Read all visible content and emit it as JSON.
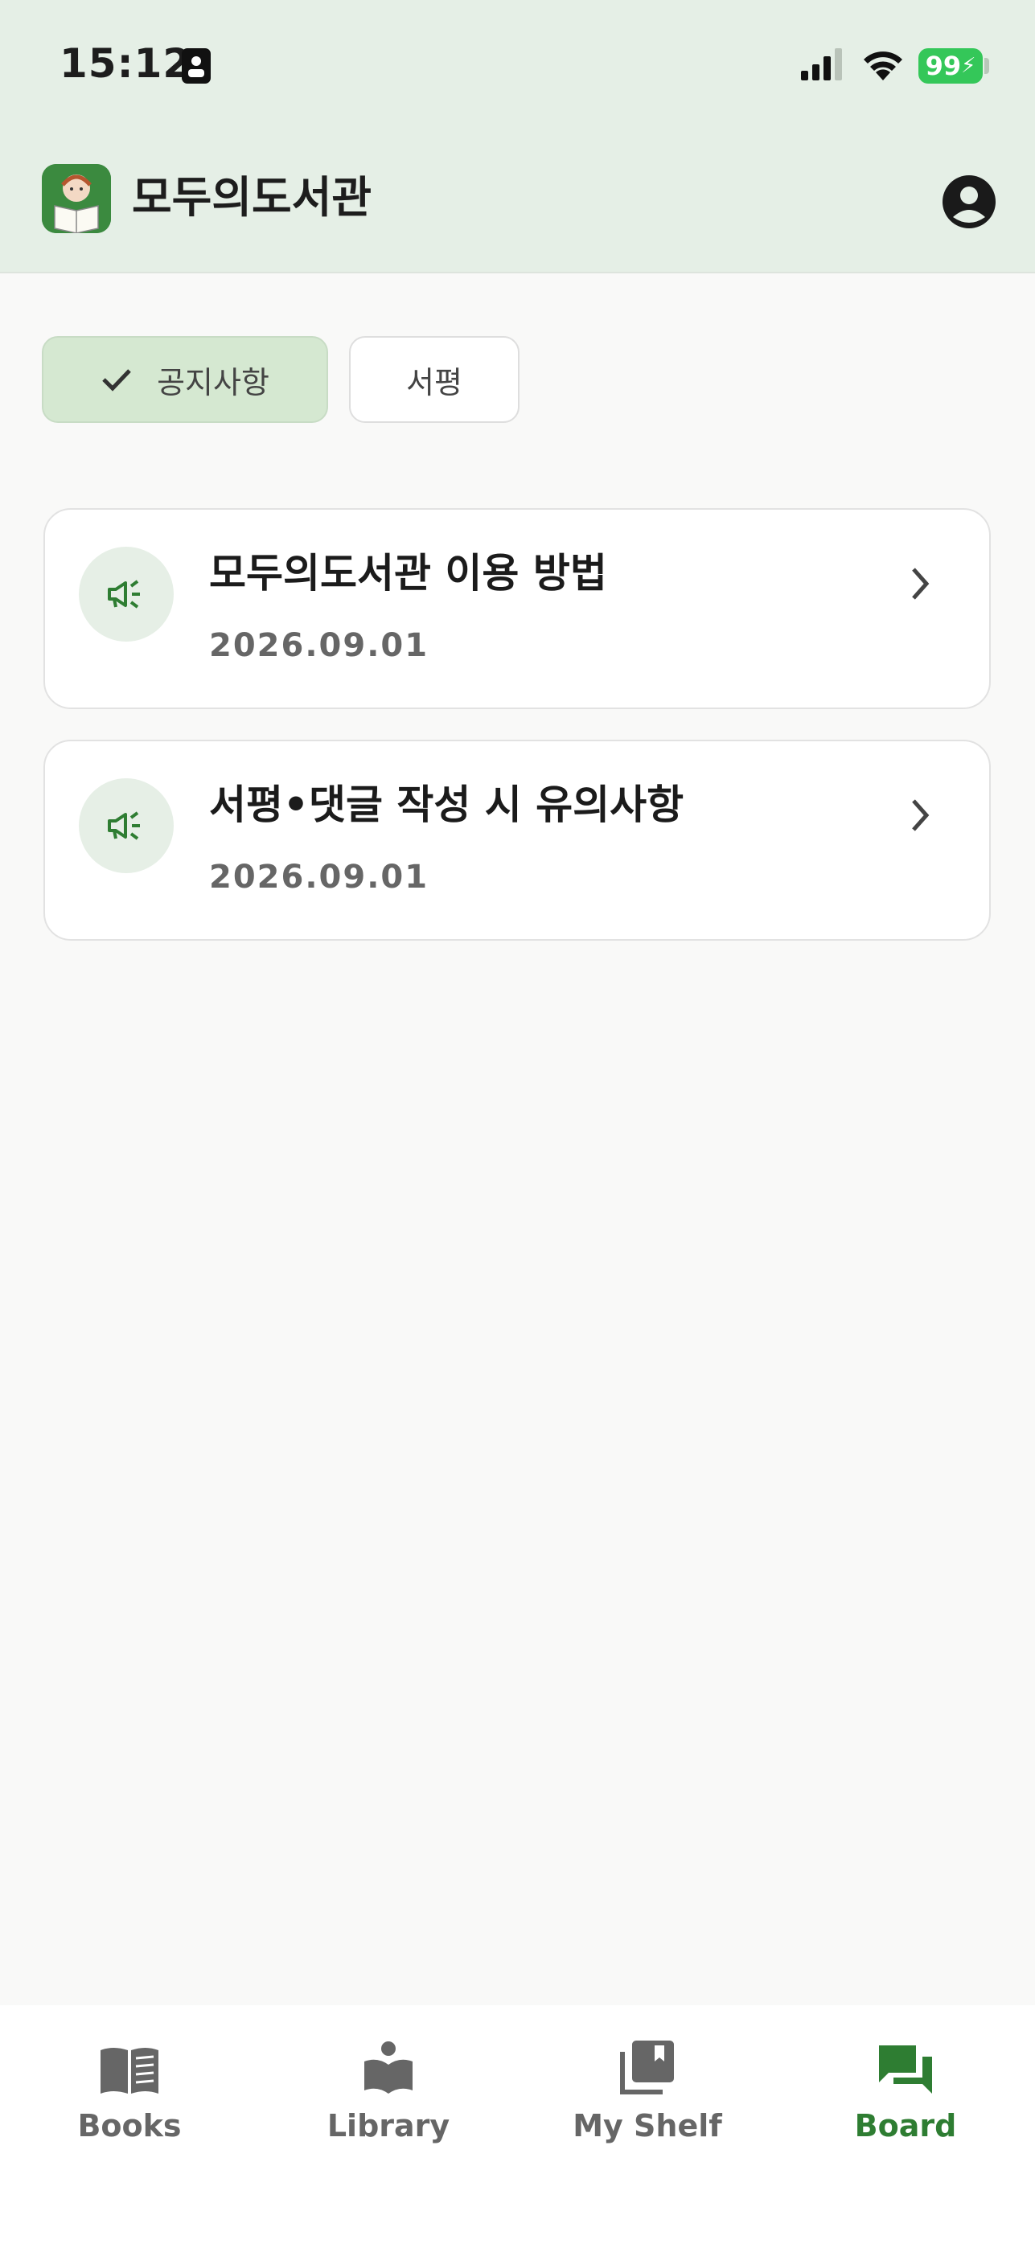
{
  "status_bar": {
    "time": "15:12",
    "battery": "99"
  },
  "header": {
    "app_title": "모두의도서관"
  },
  "filters": [
    {
      "label": "공지사항",
      "selected": true
    },
    {
      "label": "서평",
      "selected": false
    }
  ],
  "notices": [
    {
      "title": "모두의도서관 이용 방법",
      "date": "2026.09.01"
    },
    {
      "title": "서평•댓글 작성 시 유의사항",
      "date": "2026.09.01"
    }
  ],
  "bottom_nav": [
    {
      "label": "Books",
      "icon": "book-icon",
      "active": false
    },
    {
      "label": "Library",
      "icon": "library-icon",
      "active": false
    },
    {
      "label": "My Shelf",
      "icon": "shelf-icon",
      "active": false
    },
    {
      "label": "Board",
      "icon": "board-icon",
      "active": true
    }
  ],
  "colors": {
    "accent": "#2e7d32",
    "header_bg": "#e5efe6",
    "chip_selected": "#d5e8d1"
  }
}
